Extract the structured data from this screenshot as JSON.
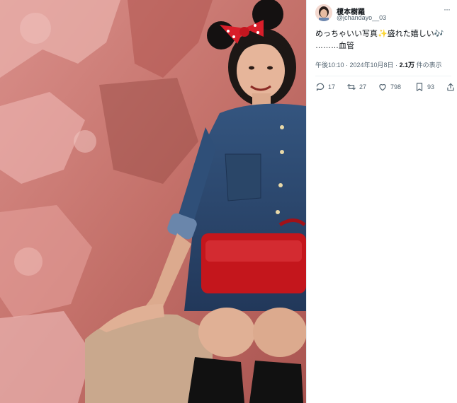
{
  "photo": {
    "alt_subject": "woman-with-minnie-ears"
  },
  "post": {
    "display_name": "榎本樹羅",
    "handle": "@jchandayo__03",
    "text_line1_a": "めっちゃいい写真",
    "text_line1_b": "盛れた嬉しい",
    "text_line2": "………血管",
    "sparkle_glyph": "✨",
    "note_glyph": "🎶",
    "timestamp": "午後10:10 · 2024年10月8日 ·",
    "views_count": "2.1万",
    "views_label": "件の表示",
    "more_glyph": "···"
  },
  "actions": {
    "replies": "17",
    "reposts": "27",
    "likes": "798",
    "bookmarks": "93"
  },
  "colors": {
    "accent": "#1d9bf0",
    "text": "#0f1419",
    "secondary": "#536471",
    "bow_red": "#d91e2a",
    "bag_red": "#c4161c",
    "denim": "#2c4a72"
  }
}
